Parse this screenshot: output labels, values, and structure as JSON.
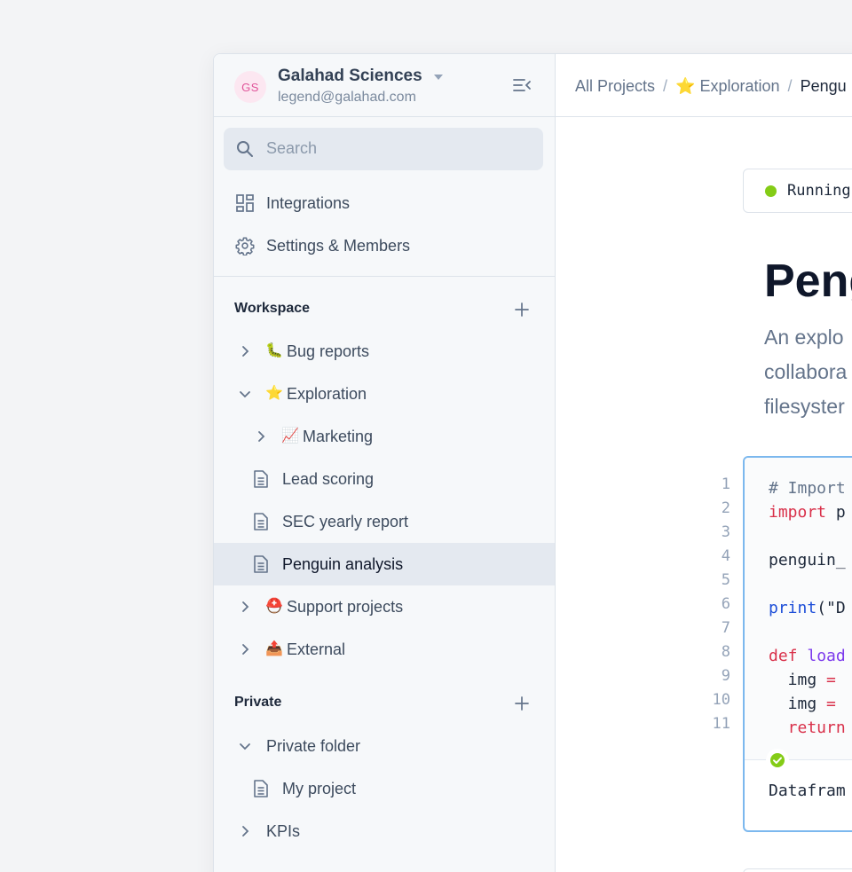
{
  "workspace": {
    "initials": "GS",
    "name": "Galahad Sciences",
    "email": "legend@galahad.com"
  },
  "search": {
    "placeholder": "Search"
  },
  "nav": [
    {
      "label": "Integrations",
      "icon": "integrations-icon"
    },
    {
      "label": "Settings & Members",
      "icon": "gear-icon"
    }
  ],
  "sections": {
    "workspace_title": "Workspace",
    "private_title": "Private"
  },
  "tree": {
    "bug_reports": {
      "label": "Bug reports",
      "emoji": "🐛"
    },
    "exploration": {
      "label": "Exploration",
      "emoji": "⭐"
    },
    "marketing": {
      "label": "Marketing",
      "emoji": "📈"
    },
    "lead_scoring": {
      "label": "Lead scoring"
    },
    "sec_report": {
      "label": "SEC yearly report"
    },
    "penguin": {
      "label": "Penguin analysis"
    },
    "support": {
      "label": "Support projects",
      "emoji": "⛑️"
    },
    "external": {
      "label": "External",
      "emoji": "📤"
    },
    "private_folder": {
      "label": "Private folder"
    },
    "my_project": {
      "label": "My project"
    },
    "kpis": {
      "label": "KPIs"
    }
  },
  "breadcrumb": {
    "all": "All Projects",
    "sep": "/",
    "exploration_emoji": "⭐",
    "exploration": "Exploration",
    "current": "Pengu"
  },
  "project": {
    "status": "Running",
    "title": "Peng",
    "description": [
      "An explo",
      "collabora",
      "filesyster"
    ]
  },
  "cell": {
    "line_numbers": [
      "1",
      "2",
      "3",
      "4",
      "5",
      "6",
      "7",
      "8",
      "9",
      "10",
      "11"
    ],
    "code": {
      "l1": "# Import",
      "l2_kw": "import",
      "l2_rest": " p",
      "l4": "penguin_",
      "l6_fn": "print",
      "l6_rest": "(\"D",
      "l8_kw": "def",
      "l8_fn": "load",
      "l9_a": "  img ",
      "l9_op": "=",
      "l10_a": "  img ",
      "l10_op": "=",
      "l11_kw": "  return"
    },
    "output": "Datafram"
  },
  "colors": {
    "accent": "#7cb8ee",
    "status_running": "#84cc16",
    "keyword": "#d9304a"
  }
}
